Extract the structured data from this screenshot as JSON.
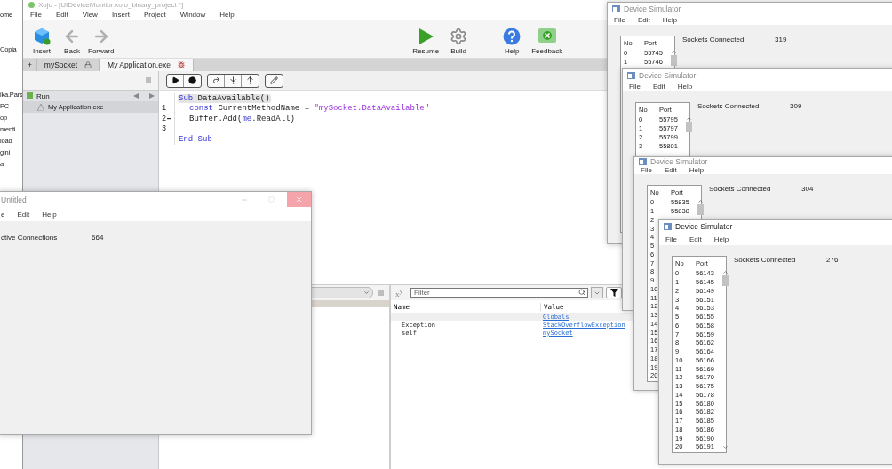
{
  "explorer": [
    {
      "kind": "tab",
      "label": "ome"
    },
    {
      "kind": "button",
      "label": "Copia"
    },
    {
      "kind": "path",
      "label": "ika.Pars"
    },
    {
      "kind": "nav",
      "label": "PC"
    },
    {
      "kind": "nav",
      "label": "op"
    },
    {
      "kind": "nav",
      "label": "menti"
    },
    {
      "kind": "nav",
      "label": "load"
    },
    {
      "kind": "nav",
      "label": "gini"
    },
    {
      "kind": "nav",
      "label": "a"
    }
  ],
  "ide": {
    "title": "Xojo - [UIDeviceMonitor.xojo_binary_project *]",
    "menu": [
      "File",
      "Edit",
      "View",
      "Insert",
      "Project",
      "Window",
      "Help"
    ],
    "toolbar": [
      {
        "kind": "insert",
        "label": "Insert"
      },
      {
        "kind": "back",
        "label": "Back"
      },
      {
        "kind": "forward",
        "label": "Forward"
      },
      {
        "kind": "resume",
        "label": "Resume"
      },
      {
        "kind": "build",
        "label": "Build"
      },
      {
        "kind": "help",
        "label": "Help"
      },
      {
        "kind": "feedback",
        "label": "Feedback"
      }
    ],
    "tabs": [
      {
        "kind": "add",
        "label": "+",
        "selected": false
      },
      {
        "kind": "locked",
        "label": "mySocket",
        "selected": false
      },
      {
        "kind": "debug",
        "label": "My Application.exe",
        "selected": true
      }
    ],
    "navigator": {
      "group": "Run",
      "items": [
        {
          "label": "My Application.exe",
          "selected": true
        }
      ]
    },
    "code": [
      {
        "indented": false,
        "marker": false,
        "tokens": [
          {
            "kind": "keyword",
            "text": "Sub"
          },
          {
            "kind": "plain",
            "text": " DataAvailable()"
          }
        ]
      },
      {
        "number": "1",
        "indented": true,
        "marker": false,
        "tokens": [
          {
            "kind": "keyword",
            "text": "const"
          },
          {
            "kind": "plain",
            "text": " CurrentMethodName = "
          },
          {
            "kind": "string",
            "text": "\"mySocket.DataAvailable\""
          }
        ]
      },
      {
        "number": "2",
        "indented": true,
        "marker": true,
        "tokens": [
          {
            "kind": "plain",
            "text": "Buffer.Add("
          },
          {
            "kind": "keyword",
            "text": "me"
          },
          {
            "kind": "plain",
            "text": ".ReadAll)"
          }
        ]
      },
      {
        "number": "3",
        "marker": false
      },
      {
        "indented": false,
        "marker": false,
        "tokens": [
          {
            "kind": "keyword",
            "text": "End Sub"
          }
        ]
      }
    ],
    "variables": {
      "toggle": "x$^{y}$",
      "filter_placeholder": "Filter",
      "columns": [
        "Name",
        "Value"
      ],
      "rows": [
        {
          "value": "Globals",
          "selected": true
        },
        {
          "name": "Exception",
          "value": "StackOverflowException",
          "selected": false
        },
        {
          "name": "self",
          "value": "mySocket",
          "selected": false
        }
      ]
    }
  },
  "untitled_window": {
    "title": "Untitled",
    "menu": [
      "e",
      "Edit",
      "Help"
    ],
    "label": "ctive Connections",
    "value": "664"
  },
  "simulators": [
    {
      "title": "Device Simulator",
      "menu": [
        "File",
        "Edit",
        "Help"
      ],
      "label": "Sockets Connected",
      "count": "319",
      "columns": [
        "No",
        "Port"
      ],
      "rows": [
        {
          "no": "0",
          "port": "55745"
        },
        {
          "no": "1",
          "port": "55746"
        }
      ]
    },
    {
      "title": "Device Simulator",
      "menu": [
        "File",
        "Edit",
        "Help"
      ],
      "label": "Sockets Connected",
      "count": "309",
      "columns": [
        "No",
        "Port"
      ],
      "rows": [
        {
          "no": "0",
          "port": "55795"
        },
        {
          "no": "1",
          "port": "55797"
        },
        {
          "no": "2",
          "port": "55799"
        },
        {
          "no": "3",
          "port": "55801"
        }
      ]
    },
    {
      "title": "Device Simulator",
      "menu": [
        "File",
        "Edit",
        "Help"
      ],
      "label": "Sockets Connected",
      "count": "304",
      "columns": [
        "No",
        "Port"
      ],
      "rows": [
        {
          "no": "0",
          "port": "55835"
        },
        {
          "no": "1",
          "port": "55838"
        },
        {
          "no": "2"
        },
        {
          "no": "3"
        },
        {
          "no": "4"
        },
        {
          "no": "5"
        },
        {
          "no": "6"
        },
        {
          "no": "7"
        },
        {
          "no": "8"
        },
        {
          "no": "9"
        },
        {
          "no": "10"
        },
        {
          "no": "11"
        },
        {
          "no": "12"
        },
        {
          "no": "13"
        },
        {
          "no": "14"
        },
        {
          "no": "15"
        },
        {
          "no": "16"
        },
        {
          "no": "17"
        },
        {
          "no": "18"
        },
        {
          "no": "19"
        },
        {
          "no": "20"
        }
      ]
    },
    {
      "title": "Device Simulator",
      "menu": [
        "File",
        "Edit",
        "Help"
      ],
      "label": "Sockets Connected",
      "count": "276",
      "columns": [
        "No",
        "Port"
      ],
      "rows": [
        {
          "no": "0",
          "port": "56143"
        },
        {
          "no": "1",
          "port": "56145"
        },
        {
          "no": "2",
          "port": "56149"
        },
        {
          "no": "3",
          "port": "56151"
        },
        {
          "no": "4",
          "port": "56153"
        },
        {
          "no": "5",
          "port": "56155"
        },
        {
          "no": "6",
          "port": "56158"
        },
        {
          "no": "7",
          "port": "56159"
        },
        {
          "no": "8",
          "port": "56162"
        },
        {
          "no": "9",
          "port": "56164"
        },
        {
          "no": "10",
          "port": "56166"
        },
        {
          "no": "11",
          "port": "56169"
        },
        {
          "no": "12",
          "port": "56170"
        },
        {
          "no": "13",
          "port": "56175"
        },
        {
          "no": "14",
          "port": "56178"
        },
        {
          "no": "15",
          "port": "56180"
        },
        {
          "no": "16",
          "port": "56182"
        },
        {
          "no": "17",
          "port": "56185"
        },
        {
          "no": "18",
          "port": "56186"
        },
        {
          "no": "19",
          "port": "56190"
        },
        {
          "no": "20",
          "port": "56191"
        }
      ]
    }
  ]
}
